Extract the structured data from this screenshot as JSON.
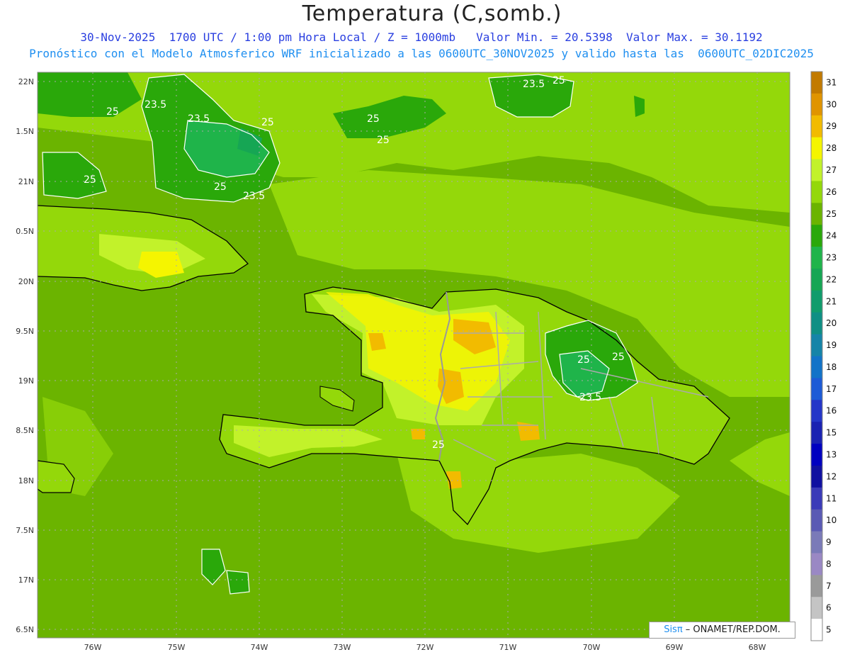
{
  "header": {
    "title": "Temperatura (C,somb.)",
    "subtitle_1": "30-Nov-2025  1700 UTC / 1:00 pm Hora Local / Z = 1000mb   Valor Min. = 20.5398  Valor Max. = 30.1192",
    "subtitle_2": "Pronóstico con el Modelo Atmosferico WRF inicializado a las 0600UTC_30NOV2025 y valido hasta las  0600UTC_02DIC2025"
  },
  "axes": {
    "lat_labels": [
      "22N",
      "1.5N",
      "21N",
      "0.5N",
      "20N",
      "9.5N",
      "19N",
      "8.5N",
      "18N",
      "7.5N",
      "17N",
      "6.5N"
    ],
    "lon_labels": [
      "76W",
      "75W",
      "74W",
      "73W",
      "72W",
      "71W",
      "70W",
      "69W",
      "68W"
    ]
  },
  "contour_labels": [
    "25",
    "23.5",
    "23.5",
    "25",
    "25",
    "25",
    "25",
    "23.5",
    "25",
    "23.5",
    "25",
    "25",
    "25",
    "23.5",
    "25"
  ],
  "colorbar": {
    "labels": [
      "31",
      "30",
      "29",
      "28",
      "27",
      "26",
      "25",
      "24",
      "23",
      "22",
      "21",
      "20",
      "19",
      "18",
      "17",
      "16",
      "15",
      "13",
      "12",
      "11",
      "10",
      "9",
      "8",
      "7",
      "6",
      "5"
    ],
    "colors": [
      "#c27a00",
      "#e09400",
      "#f2bb00",
      "#f5f500",
      "#c2f22a",
      "#94d80a",
      "#6bb400",
      "#2aa80a",
      "#1fb44a",
      "#16a654",
      "#109c6c",
      "#0f8f84",
      "#1584a8",
      "#1273c8",
      "#1d5bd6",
      "#2436c8",
      "#1a22b2",
      "#0000c0",
      "#1010a0",
      "#3a3ab8",
      "#5a5ab4",
      "#7a7ab8",
      "#9a88c4",
      "#9a9a9a",
      "#c4c4c4",
      "#ffffff"
    ]
  },
  "credit": {
    "brand": "Sisπ",
    "text": " – ONAMET/REP.DOM."
  }
}
